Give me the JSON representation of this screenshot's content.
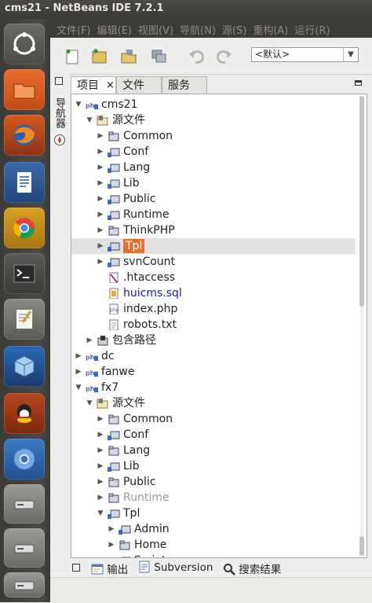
{
  "window": {
    "title": "cms21 - NetBeans IDE 7.2.1"
  },
  "menu": [
    "文件(F)",
    "编辑(E)",
    "视图(V)",
    "导航(N)",
    "源(S)",
    "重构(A)",
    "运行(R)"
  ],
  "toolbar": {
    "buttons": [
      "new-file",
      "new-project",
      "open-project",
      "close-project",
      "undo",
      "redo"
    ],
    "config_value": "<默认>"
  },
  "side_label": "导航器",
  "tabs": [
    {
      "label": "项目",
      "active": true,
      "close": "×"
    },
    {
      "label": "文件",
      "active": false
    },
    {
      "label": "服务",
      "active": false
    }
  ],
  "tree": [
    {
      "label": "cms21",
      "depth": 0,
      "state": "expanded",
      "icon": "php-project-icon"
    },
    {
      "label": "源文件",
      "depth": 1,
      "state": "expanded",
      "icon": "source-files-icon"
    },
    {
      "label": "Common",
      "depth": 2,
      "state": "collapsed",
      "icon": "folder-icon"
    },
    {
      "label": "Conf",
      "depth": 2,
      "state": "collapsed",
      "icon": "vcs-folder-icon"
    },
    {
      "label": "Lang",
      "depth": 2,
      "state": "collapsed",
      "icon": "vcs-folder-icon"
    },
    {
      "label": "Lib",
      "depth": 2,
      "state": "collapsed",
      "icon": "vcs-folder-icon"
    },
    {
      "label": "Public",
      "depth": 2,
      "state": "collapsed",
      "icon": "vcs-folder-icon"
    },
    {
      "label": "Runtime",
      "depth": 2,
      "state": "collapsed",
      "icon": "vcs-folder-icon"
    },
    {
      "label": "ThinkPHP",
      "depth": 2,
      "state": "collapsed",
      "icon": "folder-icon"
    },
    {
      "label": "Tpl",
      "depth": 2,
      "state": "collapsed",
      "icon": "vcs-folder-icon",
      "selected": true
    },
    {
      "label": "svnCount",
      "depth": 2,
      "state": "collapsed",
      "icon": "vcs-folder-icon"
    },
    {
      "label": ".htaccess",
      "depth": 2,
      "state": "leaf",
      "icon": "htaccess-file-icon"
    },
    {
      "label": "huicms.sql",
      "depth": 2,
      "state": "leaf",
      "icon": "sql-file-icon",
      "style": "blue"
    },
    {
      "label": "index.php",
      "depth": 2,
      "state": "leaf",
      "icon": "php-file-icon"
    },
    {
      "label": "robots.txt",
      "depth": 2,
      "state": "leaf",
      "icon": "text-file-icon"
    },
    {
      "label": "包含路径",
      "depth": 1,
      "state": "collapsed",
      "icon": "include-path-icon"
    },
    {
      "label": "dc",
      "depth": 0,
      "state": "collapsed",
      "icon": "php-project-icon"
    },
    {
      "label": "fanwe",
      "depth": 0,
      "state": "collapsed",
      "icon": "php-project-icon"
    },
    {
      "label": "fx7",
      "depth": 0,
      "state": "expanded",
      "icon": "php-project-icon"
    },
    {
      "label": "源文件",
      "depth": 1,
      "state": "expanded",
      "icon": "source-files-icon"
    },
    {
      "label": "Common",
      "depth": 2,
      "state": "collapsed",
      "icon": "folder-icon"
    },
    {
      "label": "Conf",
      "depth": 2,
      "state": "collapsed",
      "icon": "vcs-folder-icon"
    },
    {
      "label": "Lang",
      "depth": 2,
      "state": "collapsed",
      "icon": "folder-icon"
    },
    {
      "label": "Lib",
      "depth": 2,
      "state": "collapsed",
      "icon": "vcs-folder-icon"
    },
    {
      "label": "Public",
      "depth": 2,
      "state": "collapsed",
      "icon": "folder-icon"
    },
    {
      "label": "Runtime",
      "depth": 2,
      "state": "collapsed",
      "icon": "folder-icon",
      "style": "dim"
    },
    {
      "label": "Tpl",
      "depth": 2,
      "state": "expanded",
      "icon": "vcs-folder-icon"
    },
    {
      "label": "Admin",
      "depth": 3,
      "state": "collapsed",
      "icon": "vcs-folder-icon"
    },
    {
      "label": "Home",
      "depth": 3,
      "state": "collapsed",
      "icon": "folder-icon"
    },
    {
      "label": "Script",
      "depth": 3,
      "state": "collapsed",
      "icon": "vcs-folder-icon"
    }
  ],
  "bottom_tabs": [
    {
      "label": "输出",
      "icon": "output-icon"
    },
    {
      "label": "Subversion",
      "icon": "subversion-icon"
    },
    {
      "label": "搜索结果",
      "icon": "search-icon"
    }
  ],
  "launcher": [
    "ubuntu-dash-icon",
    "files-icon",
    "firefox-icon",
    "writer-icon",
    "chrome-icon",
    "terminal-icon",
    "text-editor-icon",
    "virtualbox-icon",
    "qq-icon",
    "chromium-icon",
    "drive-icon",
    "drive-icon",
    "drive-icon"
  ],
  "colors": {
    "selection": "#e6702e",
    "menubar": "#3c3b37",
    "launcher": "#3b3a37"
  }
}
